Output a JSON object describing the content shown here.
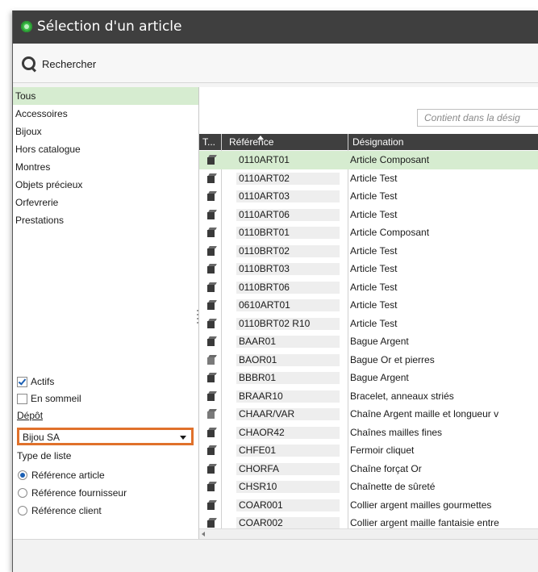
{
  "window": {
    "title": "Sélection d'un article"
  },
  "toolbar": {
    "search_label": "Rechercher"
  },
  "categories": [
    "Tous",
    "Accessoires",
    "Bijoux",
    "Hors catalogue",
    "Montres",
    "Objets précieux",
    "Orfevrerie",
    "Prestations"
  ],
  "filters": {
    "actifs_label": "Actifs",
    "actifs_checked": true,
    "sommeil_label": "En sommeil",
    "sommeil_checked": false,
    "depot_label": "Dépôt",
    "depot_value": "Bijou SA",
    "type_liste_label": "Type de liste",
    "type_options": [
      {
        "label": "Référence article",
        "selected": true
      },
      {
        "label": "Référence fournisseur",
        "selected": false
      },
      {
        "label": "Référence client",
        "selected": false
      }
    ]
  },
  "grid": {
    "filter_placeholder": "Contient dans la désig",
    "columns": {
      "type": "T...",
      "reference": "Référence",
      "designation": "Désignation"
    },
    "rows": [
      {
        "ref": "0110ART01",
        "des": "Article Composant"
      },
      {
        "ref": "0110ART02",
        "des": "Article Test"
      },
      {
        "ref": "0110ART03",
        "des": "Article Test"
      },
      {
        "ref": "0110ART06",
        "des": "Article Test"
      },
      {
        "ref": "0110BRT01",
        "des": "Article Composant"
      },
      {
        "ref": "0110BRT02",
        "des": "Article Test"
      },
      {
        "ref": "0110BRT03",
        "des": "Article Test"
      },
      {
        "ref": "0110BRT06",
        "des": "Article Test"
      },
      {
        "ref": "0610ART01",
        "des": "Article Test"
      },
      {
        "ref": "0110BRT02 R10",
        "des": "Article Test"
      },
      {
        "ref": "BAAR01",
        "des": "Bague Argent"
      },
      {
        "ref": "BAOR01",
        "des": "Bague Or et pierres"
      },
      {
        "ref": "BBBR01",
        "des": "Bague Argent"
      },
      {
        "ref": "BRAAR10",
        "des": "Bracelet, anneaux striés"
      },
      {
        "ref": "CHAAR/VAR",
        "des": "Chaîne Argent maille et longueur v"
      },
      {
        "ref": "CHAOR42",
        "des": "Chaînes mailles fines"
      },
      {
        "ref": "CHFE01",
        "des": "Fermoir cliquet"
      },
      {
        "ref": "CHORFA",
        "des": "Chaîne forçat Or"
      },
      {
        "ref": "CHSR10",
        "des": "Chaînette de sûreté"
      },
      {
        "ref": "COAR001",
        "des": "Collier argent mailles gourmettes"
      },
      {
        "ref": "COAR002",
        "des": "Collier argent maille fantaisie entre"
      }
    ]
  }
}
